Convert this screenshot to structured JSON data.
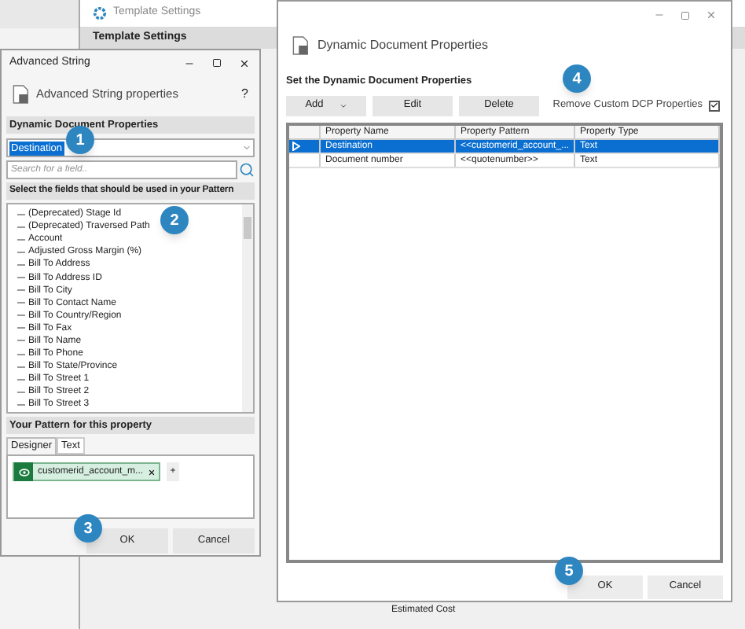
{
  "background_window": {
    "title": "Template Settings",
    "header": "Template Settings",
    "tree_items": [
      "Estimated Cost"
    ]
  },
  "advanced_string": {
    "title": "Advanced String",
    "header_title": "Advanced String properties",
    "help": "?",
    "section_dcp": "Dynamic Document Properties",
    "property_value": "Destination",
    "search": {
      "placeholder": "Search for a field.."
    },
    "fields_heading": "Select the fields that should be used in your Pattern",
    "fields": [
      "(Deprecated) Stage Id",
      "(Deprecated) Traversed Path",
      "Account",
      "Adjusted Gross Margin (%)",
      "Bill To Address",
      "Bill To Address ID",
      "Bill To City",
      "Bill To Contact Name",
      "Bill To Country/Region",
      "Bill To Fax",
      "Bill To Name",
      "Bill To Phone",
      "Bill To State/Province",
      "Bill To Street 1",
      "Bill To Street 2",
      "Bill To Street 3"
    ],
    "pattern_heading": "Your Pattern for this property",
    "tabs": [
      {
        "label": "Designer",
        "selected": true
      },
      {
        "label": "Text",
        "selected": false
      }
    ],
    "pattern_chips": [
      "customerid_account_m..."
    ],
    "add_chip": "+",
    "buttons": [
      "OK",
      "Cancel"
    ]
  },
  "dcp_dialog": {
    "header_title": "Dynamic Document Properties",
    "section": "Set the Dynamic Document Properties",
    "toolbar": [
      {
        "label": "Add",
        "kind": "dropdown"
      },
      {
        "label": "Edit",
        "kind": "plain"
      },
      {
        "label": "Delete",
        "kind": "plain"
      }
    ],
    "remove_custom": {
      "label": "Remove Custom DCP Properties",
      "checked": true
    },
    "columns": [
      "Property Name",
      "Property Pattern",
      "Property Type"
    ],
    "rows": [
      {
        "cells": [
          "Destination",
          "<<customerid_account_...",
          "Text"
        ],
        "selected": true
      },
      {
        "cells": [
          "Document number",
          "<<quotenumber>>",
          "Text"
        ],
        "selected": false
      }
    ],
    "buttons": [
      "OK",
      "Cancel"
    ]
  },
  "callouts": [
    "1",
    "2",
    "3",
    "4",
    "5"
  ]
}
